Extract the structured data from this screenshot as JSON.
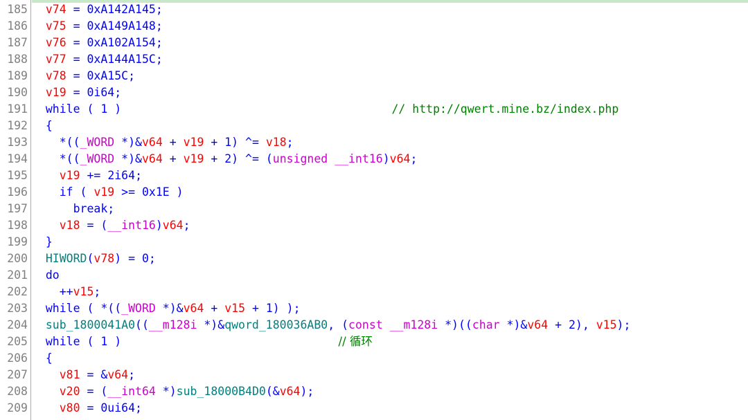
{
  "editor": {
    "name": "ida-pseudocode-view",
    "first_line_number": 185,
    "last_line_number": 209,
    "colors": {
      "background": "#ffffff",
      "line_number": "#808080",
      "gutter_rule": "#a8a8a8",
      "top_marker": "#c9e7c9",
      "variable": "#ff0000",
      "keyword": "#0000ff",
      "number": "#0000ff",
      "type": "#cc00cc",
      "function": "#008080",
      "comment": "#008000"
    }
  },
  "lines": [
    {
      "num": "185",
      "text": "  v74 = 0xA142A145;"
    },
    {
      "num": "186",
      "text": "  v75 = 0xA149A148;"
    },
    {
      "num": "187",
      "text": "  v76 = 0xA102A154;"
    },
    {
      "num": "188",
      "text": "  v77 = 0xA144A15C;"
    },
    {
      "num": "189",
      "text": "  v78 = 0xA15C;"
    },
    {
      "num": "190",
      "text": "  v19 = 0i64;"
    },
    {
      "num": "191",
      "text": "  while ( 1 )",
      "comment": "// http://qwert.mine.bz/index.php",
      "comment_col": 54
    },
    {
      "num": "192",
      "text": "  {"
    },
    {
      "num": "193",
      "text": "    *((_WORD *)&v64 + v19 + 1) ^= v18;"
    },
    {
      "num": "194",
      "text": "    *((_WORD *)&v64 + v19 + 2) ^= (unsigned __int16)v64;"
    },
    {
      "num": "195",
      "text": "    v19 += 2i64;"
    },
    {
      "num": "196",
      "text": "    if ( v19 >= 0x1E )"
    },
    {
      "num": "197",
      "text": "      break;"
    },
    {
      "num": "198",
      "text": "    v18 = (__int16)v64;"
    },
    {
      "num": "199",
      "text": "  }"
    },
    {
      "num": "200",
      "text": "  HIWORD(v78) = 0;"
    },
    {
      "num": "201",
      "text": "  do"
    },
    {
      "num": "202",
      "text": "    ++v15;"
    },
    {
      "num": "203",
      "text": "  while ( *((_WORD *)&v64 + v15 + 1) );"
    },
    {
      "num": "204",
      "text": "  sub_1800041A0((__m128i *)&qword_180036AB0, (const __m128i *)((char *)&v64 + 2), v15);"
    },
    {
      "num": "205",
      "text": "  while ( 1 )",
      "comment": "// 循环",
      "comment_col": 46
    },
    {
      "num": "206",
      "text": "  {"
    },
    {
      "num": "207",
      "text": "    v81 = &v64;"
    },
    {
      "num": "208",
      "text": "    v20 = (__int64 *)sub_18000B4D0(&v64);"
    },
    {
      "num": "209",
      "text": "    v80 = 0ui64;"
    }
  ],
  "tokens": {
    "keywords": [
      "while",
      "if",
      "do",
      "break"
    ],
    "types": [
      "_WORD",
      "__int16",
      "__int64",
      "__m128i",
      "unsigned",
      "const",
      "char"
    ],
    "functions": [
      "HIWORD",
      "sub_1800041A0",
      "qword_180036AB0",
      "sub_18000B4D0"
    ],
    "variables": [
      "v15",
      "v18",
      "v19",
      "v20",
      "v64",
      "v74",
      "v75",
      "v76",
      "v77",
      "v78",
      "v80",
      "v81"
    ],
    "comments": [
      "// http://qwert.mine.bz/index.php",
      "// 循环"
    ]
  }
}
